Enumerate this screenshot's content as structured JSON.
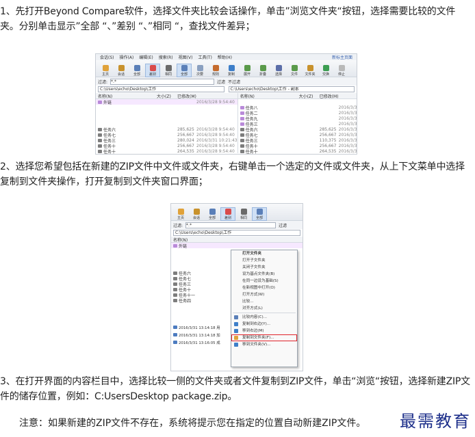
{
  "paragraphs": {
    "p1": "1、先打开Beyond Compare软件，选择文件夹比较会话操作，单击”浏览文件夹“按钮，选择需要比较的文件夹。分别单击显示”全部 “、”差别 “、”相同 “，查找文件差异；",
    "p2": "2、选择您希望包括在新建的ZIP文件中文件或文件夹，右键单击一个选定的文件或文件夹，从上下文菜单中选择复制到文件夹操作，打开复制到文件夹窗口界面；",
    "p3": "3、在打开界面的内容栏目中，选择比较一侧的文件夹或者文件复制到ZIP文件，单击“浏览“按钮，选择新建ZIP文件的储存位置，例如：C:UsersDesktop package.zip。",
    "note": "注意：如果新建的ZIP文件不存在，系统将提示您在指定的位置自动新建ZIP文件。"
  },
  "watermark": "最需教育",
  "shot1": {
    "menu": [
      "会话(S)",
      "操作(A)",
      "编辑(E)",
      "搜索(R)",
      "视图(V)",
      "工具(T)",
      "帮助(H)"
    ],
    "menu_right": "新标主页面",
    "toolbar": [
      {
        "label": "主页",
        "color": "#e0a23a"
      },
      {
        "label": "会话",
        "color": "#c8922d"
      },
      {
        "label": "全部",
        "color": "#5a7fb8"
      },
      {
        "label": "差别",
        "color": "#d94b4b",
        "selected": true
      },
      {
        "label": "相同",
        "color": "#6a6a6a"
      },
      {
        "label": "全部",
        "color": "#5a7fb8",
        "selected": true
      },
      {
        "label": "次要",
        "color": "#8aa0c0"
      },
      {
        "label": "规则",
        "color": "#c56b2d"
      },
      {
        "label": "复制",
        "color": "#3e7fc9"
      },
      {
        "label": "展开",
        "color": "#5a9a4a"
      },
      {
        "label": "折叠",
        "color": "#5a9a4a"
      },
      {
        "label": "选择",
        "color": "#5b6ea8"
      },
      {
        "label": "文件",
        "color": "#5a9a4a"
      },
      {
        "label": "文件夹",
        "color": "#c8922d"
      },
      {
        "label": "交换",
        "color": "#3d9e52"
      },
      {
        "label": "停止",
        "color": "#b9b9b9"
      }
    ],
    "filter_label": "过滤:",
    "filter_value": "*.*",
    "filter_btn": "过滤",
    "nofilter_btn": "不过滤",
    "left_path": "C:\\Users\\echo\\Desktop\\工作",
    "right_path": "C:\\Users\\echo\\Desktop\\工作 - 副本",
    "headers": [
      "名称(N)",
      "大小(Z)",
      "已修改(M)"
    ],
    "left_rows": [
      {
        "name": "外链",
        "size": "",
        "date": "2016/3/28 9:54:40",
        "color": "p",
        "hl": true
      },
      {
        "name": "",
        "size": "",
        "date": "",
        "color": ""
      },
      {
        "name": "",
        "size": "",
        "date": "",
        "color": ""
      },
      {
        "name": "",
        "size": "",
        "date": "",
        "color": ""
      },
      {
        "name": "",
        "size": "",
        "date": "",
        "color": ""
      },
      {
        "name": "任务六",
        "size": "285,625",
        "date": "2016/3/28 9:54:40",
        "color": "g"
      },
      {
        "name": "任务七",
        "size": "256,667",
        "date": "2016/3/28 9:54:40",
        "color": "g"
      },
      {
        "name": "任务三",
        "size": "280,024",
        "date": "2016/3/31 10:21:43",
        "color": "g"
      },
      {
        "name": "任务十",
        "size": "256,667",
        "date": "2016/3/28 9:54:40",
        "color": "g"
      },
      {
        "name": "任务十",
        "size": "264,535",
        "date": "2016/3/28 9:54:40",
        "color": "g"
      }
    ],
    "right_rows": [
      {
        "name": "",
        "size": "",
        "date": "",
        "color": ""
      },
      {
        "name": "任务八",
        "size": "",
        "date": "2016/3/31 9:53:52",
        "color": "p"
      },
      {
        "name": "任务二",
        "size": "",
        "date": "2016/3/31 9:53:52",
        "color": "p"
      },
      {
        "name": "任务九",
        "size": "",
        "date": "2016/3/31 9:53:52",
        "color": "p"
      },
      {
        "name": "任务三",
        "size": "",
        "date": "2016/3/31 9:53:52",
        "color": "p"
      },
      {
        "name": "任务六",
        "size": "285,625",
        "date": "2016/3/31 9:53:52",
        "color": "g"
      },
      {
        "name": "任务七",
        "size": "256,667",
        "date": "2016/3/31 9:53:52",
        "color": "g"
      },
      {
        "name": "任务三",
        "size": "110,375",
        "date": "2016/3/31 9:53:52",
        "color": "g"
      },
      {
        "name": "任务十",
        "size": "256,667",
        "date": "2016/3/31 9:53:52",
        "color": "g"
      },
      {
        "name": "任务十",
        "size": "264,535",
        "date": "2016/3/31 9:53:52",
        "color": "g"
      }
    ]
  },
  "shot2": {
    "toolbar": [
      {
        "label": "主页",
        "color": "#e0a23a"
      },
      {
        "label": "会话",
        "color": "#c8922d"
      },
      {
        "label": "全部",
        "color": "#5a7fb8"
      },
      {
        "label": "差别",
        "color": "#d94b4b",
        "selected": true
      },
      {
        "label": "相同",
        "color": "#6a6a6a"
      },
      {
        "label": "全部",
        "color": "#5a7fb8",
        "selected": true
      }
    ],
    "filter_label": "过滤:",
    "filter_value": "*.*",
    "filter_btn": "过滤",
    "path": "C:\\Users\\echo\\Desktop\\工作",
    "header_name": "名称(N)",
    "rows": [
      {
        "name": "外链",
        "color": "p",
        "hl": true
      },
      {
        "name": "",
        "color": ""
      },
      {
        "name": "",
        "color": ""
      },
      {
        "name": "",
        "color": ""
      },
      {
        "name": "",
        "color": ""
      },
      {
        "name": "任务六",
        "color": "g"
      },
      {
        "name": "任务七",
        "color": "g"
      },
      {
        "name": "任务三",
        "color": "g"
      },
      {
        "name": "任务十",
        "color": "g"
      },
      {
        "name": "任务十一",
        "color": "g"
      },
      {
        "name": "任务四",
        "color": "g"
      }
    ],
    "logs": [
      "2016/3/31 13:14:18 用",
      "2016/3/31 13:14:18 加",
      "2016/3/31 13:16:05 成"
    ],
    "menu": [
      {
        "label": "打开文件夹",
        "bold": true
      },
      {
        "label": "打开子文件夹"
      },
      {
        "label": "关闭子文件夹"
      },
      {
        "label": "设为基点文件夹(B)"
      },
      {
        "label": "在同一边设为基础(S)"
      },
      {
        "label": "在新视图中打开(O)"
      },
      {
        "label": "打开方式(W)"
      },
      {
        "label": "比较..."
      },
      {
        "label": "对齐方式(L)"
      },
      {
        "sep": true
      },
      {
        "label": "比较内容(C)...",
        "icon": "#5a7fb8"
      },
      {
        "label": "复制到右边(Y)...",
        "icon": "#3e7fc9"
      },
      {
        "label": "移到右边(M)",
        "icon": "#3e7fc9"
      },
      {
        "label": "复制到文件夹(F)...",
        "icon": "#e0a23a",
        "red": true
      },
      {
        "label": "移到文件夹(V)...",
        "icon": "#3e7fc9"
      }
    ]
  }
}
